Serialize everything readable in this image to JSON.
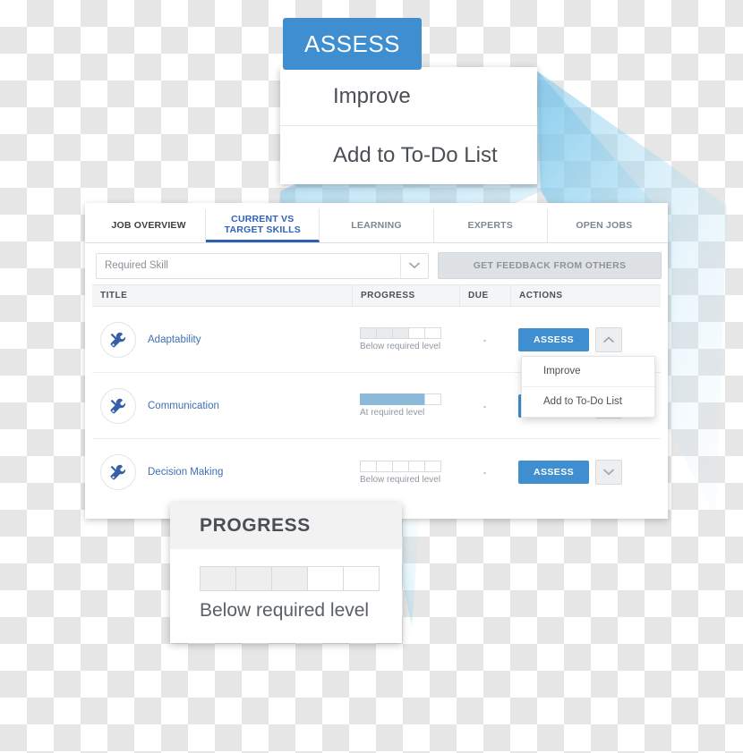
{
  "assess_callout": {
    "button_label": "ASSESS",
    "menu_items": [
      {
        "label": "Improve"
      },
      {
        "label": "Add to To-Do List"
      }
    ]
  },
  "app": {
    "tabs": [
      {
        "label": "JOB OVERVIEW",
        "active": false,
        "style": "dark"
      },
      {
        "label_line1": "CURRENT VS",
        "label_line2": "TARGET SKILLS",
        "active": true
      },
      {
        "label": "LEARNING",
        "active": false
      },
      {
        "label": "EXPERTS",
        "active": false
      },
      {
        "label": "OPEN JOBS",
        "active": false
      }
    ],
    "filter": {
      "select_value": "Required Skill",
      "select_placeholder": "Required Skill",
      "caret_icon": "chevron-down-icon",
      "feedback_button": "GET FEEDBACK FROM OTHERS"
    },
    "table": {
      "headers": [
        "TITLE",
        "PROGRESS",
        "DUE",
        "ACTIONS"
      ],
      "rows": [
        {
          "icon": "tools-icon",
          "title": "Adaptability",
          "progress_filled": 3,
          "progress_total": 5,
          "progress_style": "gray",
          "progress_label": "Below required level",
          "due": "-",
          "action_label": "ASSESS",
          "caret_icon": "chevron-up-icon",
          "menu_open": true,
          "menu_items": [
            {
              "label": "Improve"
            },
            {
              "label": "Add to To-Do List"
            }
          ]
        },
        {
          "icon": "tools-icon",
          "title": "Communication",
          "progress_filled": 4,
          "progress_total": 5,
          "progress_style": "blue",
          "progress_label": "At required level",
          "due": "-",
          "action_label": "ASSESS",
          "caret_icon": "chevron-down-icon",
          "menu_open": false
        },
        {
          "icon": "tools-icon",
          "title": "Decision Making",
          "progress_filled": 0,
          "progress_total": 5,
          "progress_style": "gray",
          "progress_label": "Below required level",
          "due": "-",
          "action_label": "ASSESS",
          "caret_icon": "chevron-down-icon",
          "menu_open": false
        }
      ]
    }
  },
  "progress_callout": {
    "title": "PROGRESS",
    "filled": 3,
    "total": 5,
    "label": "Below required level"
  },
  "colors": {
    "accent_blue": "#3f8ed0",
    "active_tab_blue": "#2f62b8",
    "tab_underline": "#2f5fb0",
    "beam_blue": "#6cc0e8",
    "progress_fill_gray": "#e9ebed",
    "progress_fill_blue": "#8cb9d9",
    "skill_link_blue": "#3e6fb5"
  }
}
